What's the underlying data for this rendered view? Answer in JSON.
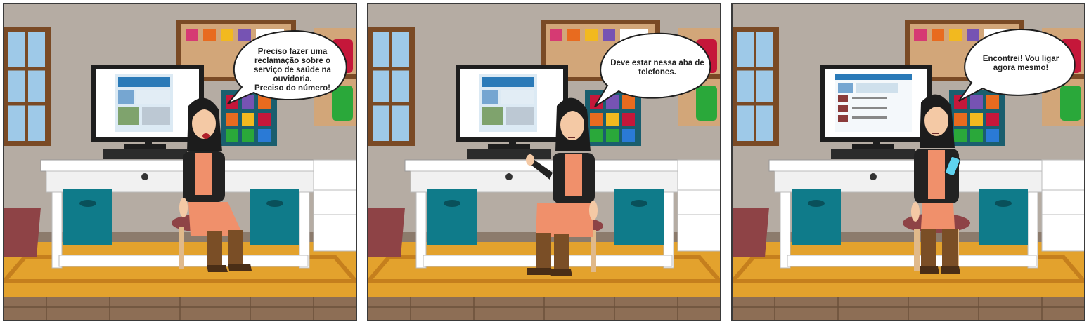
{
  "panels": [
    {
      "speech": "Preciso fazer uma\nreclamação sobre o\nserviço de saúde na\nouvidoria.\nPreciso do número!"
    },
    {
      "speech": "Deve estar nessa aba de\ntelefones."
    },
    {
      "speech": "Encontrei! Vou ligar\nagora mesmo!"
    }
  ],
  "colors": {
    "wall": "#b5aca3",
    "rug": "#e3a22d",
    "floor": "#8d6e55",
    "storage_bin": "#0f7b8a",
    "dress": "#f0906b",
    "boots": "#7a4e26"
  }
}
